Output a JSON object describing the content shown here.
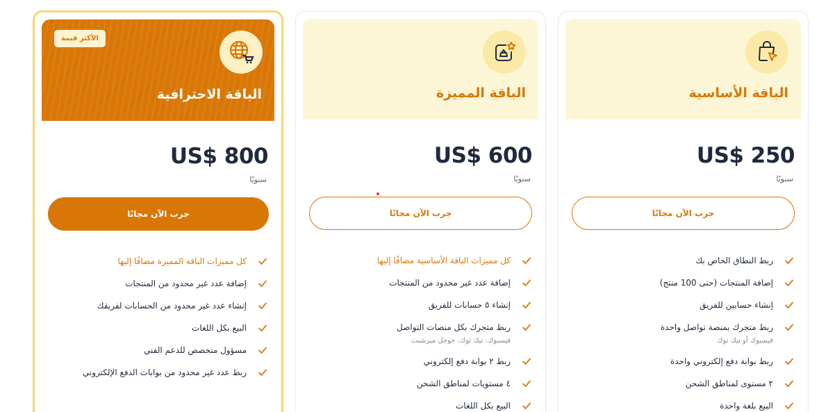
{
  "colors": {
    "accent": "#d97706",
    "accent_light": "#fdf6d6",
    "featured_border": "#f6d873",
    "text": "#1f2a3c"
  },
  "plans": [
    {
      "id": "pro",
      "name": "الباقة الاحترافية",
      "badge": "الأكثر قيمة",
      "icon": "globe-cart-icon",
      "price": "US$ 800",
      "period": "سنويًا",
      "cta": "جرب الآن مجانًا",
      "features": [
        {
          "text": "كل مميزات الباقة المميزة مضافًا إليها",
          "accent": true
        },
        {
          "text": "إضافة عدد غير محدود من المنتجات"
        },
        {
          "text": "إنشاء عدد غير محدود من الحسابات لفريقك"
        },
        {
          "text": "البيع بكل اللغات"
        },
        {
          "text": "مسؤول متخصص للدعم الفني"
        },
        {
          "text": "ربط عدد غير محدود من بوابات الدفع الإلكتروني"
        }
      ]
    },
    {
      "id": "premium",
      "name": "الباقة المميزة",
      "icon": "star-basket-icon",
      "price": "US$ 600",
      "period": "سنويًا",
      "cta": "جرب الآن مجانًا",
      "features": [
        {
          "text": "كل مميزات الباقة الأساسية مضافًا إليها",
          "accent": true
        },
        {
          "text": "إضافة عدد غير محدود من المنتجات"
        },
        {
          "text": "إنشاء ٥ حسابات للفريق"
        },
        {
          "text": "ربط متجرك بكل منصات التواصل",
          "sub": "فيسبوك، تيك توك، جوجل ميرشنت"
        },
        {
          "text": "ربط ٢ بوابة دفع إلكتروني"
        },
        {
          "text": "٤ مستويات لمناطق الشحن"
        },
        {
          "text": "البيع بكل اللغات"
        }
      ]
    },
    {
      "id": "basic",
      "name": "الباقة الأساسية",
      "icon": "shopping-bag-cursor-icon",
      "price": "US$ 250",
      "period": "سنويًا",
      "cta": "جرب الآن مجانًا",
      "features": [
        {
          "text": "ربط النطاق الخاص بك"
        },
        {
          "text": "إضافة المنتجات (حتى 100 منتج)"
        },
        {
          "text": "إنشاء حسابين للفريق"
        },
        {
          "text": "ربط متجرك بمنصة تواصل واحدة",
          "sub": "فيسبوك أو تيك توك"
        },
        {
          "text": "ربط بوابة دفع إلكتروني واحدة"
        },
        {
          "text": "٢ مستوى لمناطق الشحن"
        },
        {
          "text": "البيع بلغة واحدة"
        }
      ]
    }
  ]
}
